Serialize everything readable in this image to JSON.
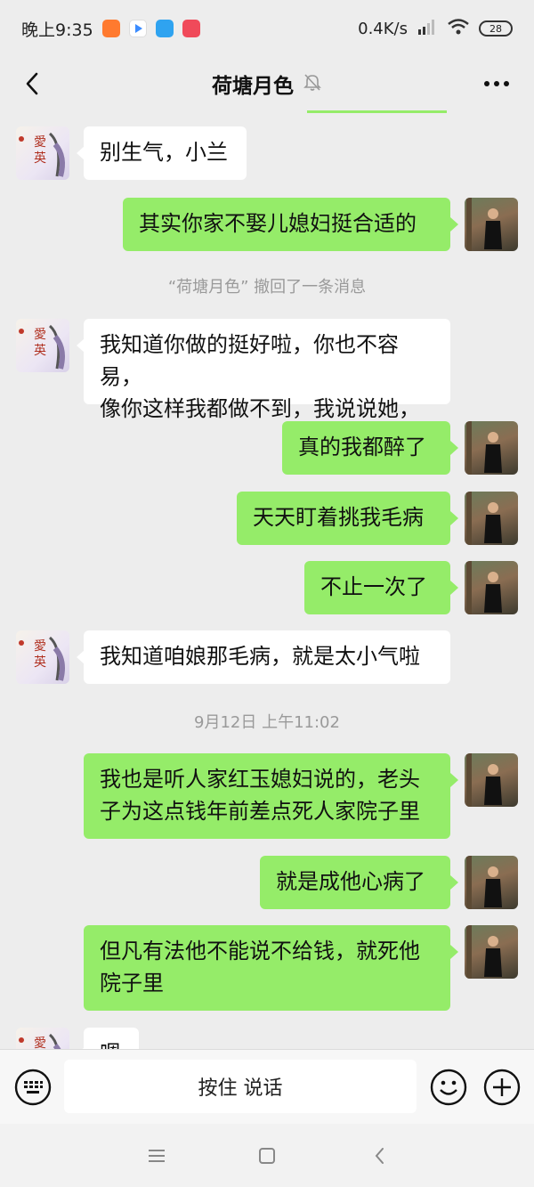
{
  "status_bar": {
    "time": "晚上9:35",
    "net_speed": "0.4K/s",
    "battery": "28",
    "app_icons": [
      "taobao-icon",
      "video-icon",
      "app-store-icon",
      "douyin-icon"
    ]
  },
  "header": {
    "title": "荷塘月色",
    "mute_icon": "bell-off-icon",
    "back_icon": "chevron-left-icon",
    "more_icon": "more-horizontal-icon"
  },
  "messages": [
    {
      "side": "other",
      "text": "别生气，小兰"
    },
    {
      "side": "self",
      "text": "其实你家不娶儿媳妇挺合适的"
    },
    {
      "type": "system",
      "text": "“荷塘月色” 撤回了一条消息"
    },
    {
      "side": "other",
      "lines": [
        "我知道你做的挺好啦，你也不容易，",
        "像你这样我都做不到，我说说她，"
      ]
    },
    {
      "side": "self",
      "text": "真的我都醉了"
    },
    {
      "side": "self",
      "text": "天天盯着挑我毛病"
    },
    {
      "side": "self",
      "text": "不止一次了"
    },
    {
      "side": "other",
      "text": "我知道咱娘那毛病，就是太小气啦"
    },
    {
      "type": "time",
      "text": "9月12日 上午11:02"
    },
    {
      "side": "self",
      "lines": [
        "我也是听人家红玉媳妇说的，老头",
        "子为这点钱年前差点死人家院子里"
      ]
    },
    {
      "side": "self",
      "text": "就是成他心病了"
    },
    {
      "side": "self",
      "lines": [
        "但凡有法他不能说不给钱，就死他",
        "院子里"
      ]
    },
    {
      "side": "other",
      "text": "嗯"
    }
  ],
  "input_bar": {
    "voice_label": "按住 说话",
    "keyboard_icon": "keyboard-icon",
    "emoji_icon": "emoji-icon",
    "plus_icon": "plus-icon"
  },
  "nav_bar": {
    "menu_icon": "menu-icon",
    "home_icon": "home-square-icon",
    "back_icon": "back-icon"
  },
  "colors": {
    "background": "#ededed",
    "self_bubble": "#95ec69",
    "other_bubble": "#ffffff",
    "system_text": "#9a9a9a"
  }
}
